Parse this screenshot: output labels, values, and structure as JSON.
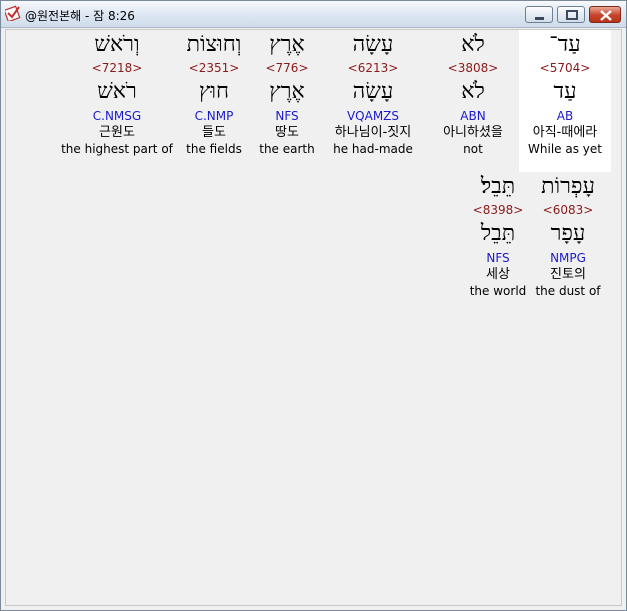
{
  "window": {
    "title": "@원전본해 - 잠 8:26",
    "icon": "checkmark-logo-icon",
    "controls": {
      "minimize": "minimize-icon",
      "maximize": "maximize-icon",
      "close": "close-icon"
    }
  },
  "words": [
    {
      "hebrew": "עַד־",
      "strongs": "<5704>",
      "lemma": "עַד",
      "parse": "AB",
      "korean": "아직-때에라",
      "english": "While as yet"
    },
    {
      "hebrew": "לֹא",
      "strongs": "<3808>",
      "lemma": "לֹא",
      "parse": "ABN",
      "korean": "아니하셨을",
      "english": "not"
    },
    {
      "hebrew": "עָשָׂה",
      "strongs": "<6213>",
      "lemma": "עָשָׂה",
      "parse": "VQAMZS",
      "korean": "하나님이-짓지",
      "english": "he had-made"
    },
    {
      "hebrew": "אֶרֶץ",
      "strongs": "<776>",
      "lemma": "אֶרֶץ",
      "parse": "NFS",
      "korean": "땅도",
      "english": "the earth"
    },
    {
      "hebrew": "וְחוּצוֹת",
      "strongs": "<2351>",
      "lemma": "חוּץ",
      "parse": "C.NMP",
      "korean": "들도",
      "english": "the fields"
    },
    {
      "hebrew": "וְרֹאשׁ",
      "strongs": "<7218>",
      "lemma": "רֹאשׁ",
      "parse": "C.NMSG",
      "korean": "근원도",
      "english": "the highest part of"
    },
    {
      "hebrew": "עָפְרוֹת",
      "strongs": "<6083>",
      "lemma": "עָפָר",
      "parse": "NMPG",
      "korean": "진토의",
      "english": "the dust of"
    },
    {
      "hebrew": "תֵּבֵל׃",
      "strongs": "<8398>",
      "lemma": "תֵּבֵל",
      "parse": "NFS",
      "korean": "세상",
      "english": "the world"
    }
  ],
  "selected_word": 0
}
